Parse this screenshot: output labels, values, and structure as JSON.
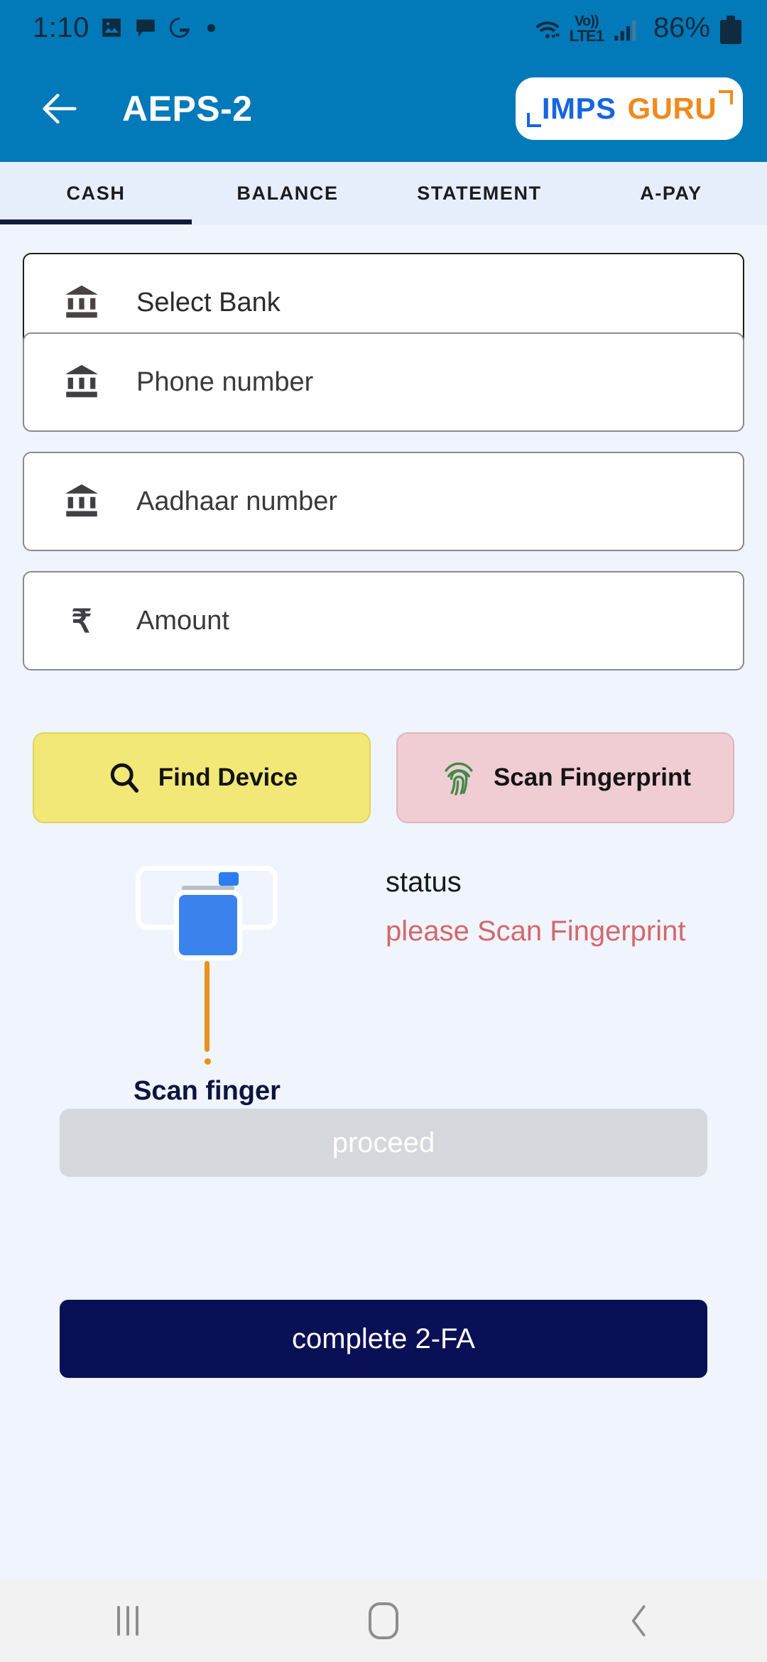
{
  "statusbar": {
    "clock": "1:10",
    "icons": [
      "image-icon",
      "message-icon",
      "google-icon",
      "dot-icon"
    ],
    "network_top": "Vo))",
    "network_bottom": "LTE1",
    "battery_percent": "86%"
  },
  "header": {
    "back_icon": "back-arrow-icon",
    "title": "AEPS-2",
    "logo": {
      "part1": "IMPS",
      "part2": "GURU",
      "part1_color": "#1565e0",
      "part2_color": "#f08a1b"
    },
    "bar_color": "#0279b8"
  },
  "tabs": [
    {
      "label": "CASH",
      "active": true
    },
    {
      "label": "BALANCE",
      "active": false
    },
    {
      "label": "STATEMENT",
      "active": false
    },
    {
      "label": "A-PAY",
      "active": false
    }
  ],
  "form": {
    "fields": [
      {
        "name": "select-bank",
        "icon": "bank-icon",
        "value": "Select Bank",
        "placeholder": "Select Bank"
      },
      {
        "name": "phone-number",
        "icon": "bank-icon",
        "value": "",
        "placeholder": "Phone number"
      },
      {
        "name": "aadhaar-number",
        "icon": "bank-icon",
        "value": "",
        "placeholder": "Aadhaar number"
      },
      {
        "name": "amount",
        "icon": "rupee-icon",
        "value": "",
        "placeholder": "Amount"
      }
    ],
    "labels": {
      "select_bank": "Select Bank",
      "phone_number": "Phone number",
      "aadhaar_number": "Aadhaar number",
      "amount": "Amount"
    }
  },
  "actions": {
    "find_device": {
      "label": "Find Device",
      "icon": "search-icon",
      "bg": "#f2e878"
    },
    "scan_fingerprint": {
      "label": "Scan Fingerprint",
      "icon": "fingerprint-icon",
      "bg": "#f0cdd3"
    }
  },
  "scanner": {
    "caption": "Scan finger",
    "device_icon": "fingerprint-scanner-icon",
    "status_title": "status",
    "status_message": "please Scan Fingerprint",
    "status_message_color": "#d4686c"
  },
  "buttons": {
    "proceed": {
      "label": "proceed",
      "enabled": false,
      "bg": "#d5d8dd"
    },
    "complete_2fa": {
      "label": "complete 2-FA",
      "enabled": true,
      "bg": "#0a1055"
    }
  },
  "navbar": {
    "recents": "recents-icon",
    "home": "home-icon",
    "back": "back-icon"
  }
}
